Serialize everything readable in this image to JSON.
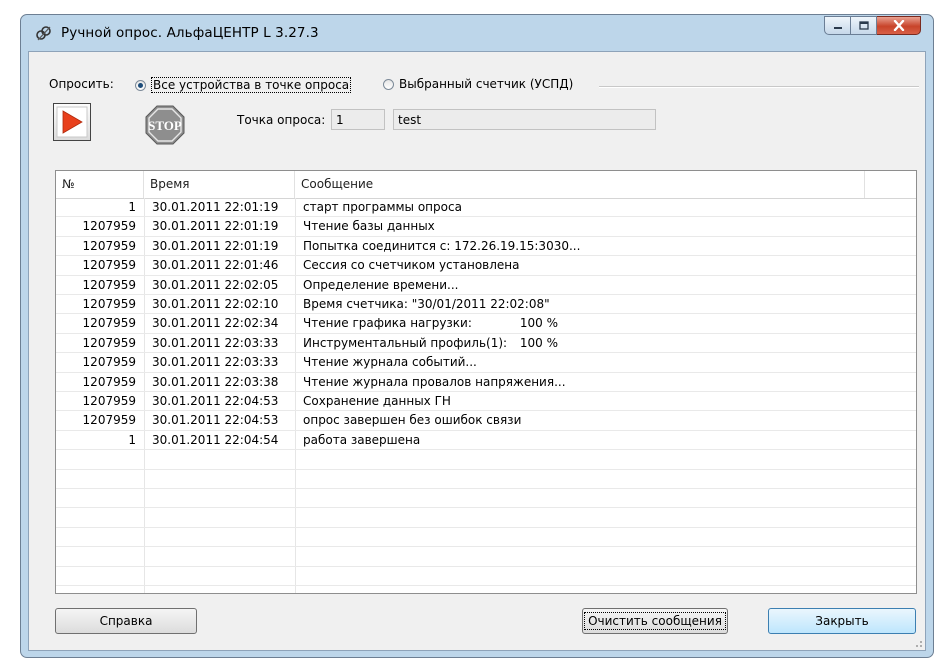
{
  "window": {
    "title": "Ручной опрос.  АльфаЦЕНТР L 3.27.3"
  },
  "poll": {
    "label": "Опросить:",
    "option_all": "Все устройства в точке опроса",
    "option_selected": "Выбранный счетчик (УСПД)",
    "selected": "option_all"
  },
  "toolbar": {
    "start_icon": "play-icon",
    "stop_label": "STOP",
    "point_label": "Точка опроса:",
    "point_number": "1",
    "point_name": "test"
  },
  "table": {
    "columns": [
      "№",
      "Время",
      "Сообщение"
    ],
    "rows": [
      {
        "num": "1",
        "time": "30.01.2011 22:01:19",
        "msg": "старт программы опроса",
        "pct": ""
      },
      {
        "num": "1207959",
        "time": "30.01.2011 22:01:19",
        "msg": "Чтение базы данных",
        "pct": ""
      },
      {
        "num": "1207959",
        "time": "30.01.2011 22:01:19",
        "msg": "Попытка соединится с: 172.26.19.15:3030...",
        "pct": ""
      },
      {
        "num": "1207959",
        "time": "30.01.2011 22:01:46",
        "msg": "Сессия со счетчиком установлена",
        "pct": ""
      },
      {
        "num": "1207959",
        "time": "30.01.2011 22:02:05",
        "msg": "Определение времени...",
        "pct": ""
      },
      {
        "num": "1207959",
        "time": "30.01.2011 22:02:10",
        "msg": "Время счетчика: \"30/01/2011 22:02:08\"",
        "pct": ""
      },
      {
        "num": "1207959",
        "time": "30.01.2011 22:02:34",
        "msg": "Чтение графика нагрузки:",
        "pct": "100 %"
      },
      {
        "num": "1207959",
        "time": "30.01.2011 22:03:33",
        "msg": "Инструментальный профиль(1):",
        "pct": "100 %"
      },
      {
        "num": "1207959",
        "time": "30.01.2011 22:03:33",
        "msg": "Чтение журнала событий...",
        "pct": ""
      },
      {
        "num": "1207959",
        "time": "30.01.2011 22:03:38",
        "msg": "Чтение журнала провалов напряжения...",
        "pct": ""
      },
      {
        "num": "1207959",
        "time": "30.01.2011 22:04:53",
        "msg": "Сохранение данных ГН",
        "pct": ""
      },
      {
        "num": "1207959",
        "time": "30.01.2011 22:04:53",
        "msg": "опрос завершен без ошибок связи",
        "pct": ""
      },
      {
        "num": "1",
        "time": "30.01.2011 22:04:54",
        "msg": "работа завершена",
        "pct": ""
      }
    ]
  },
  "buttons": {
    "help": "Справка",
    "clear": "Очистить сообщения",
    "close": "Закрыть"
  },
  "colors": {
    "frame": "#bdd6ea",
    "play_triangle": "#e8401c",
    "stop_octagon": "#8e8e8e"
  }
}
